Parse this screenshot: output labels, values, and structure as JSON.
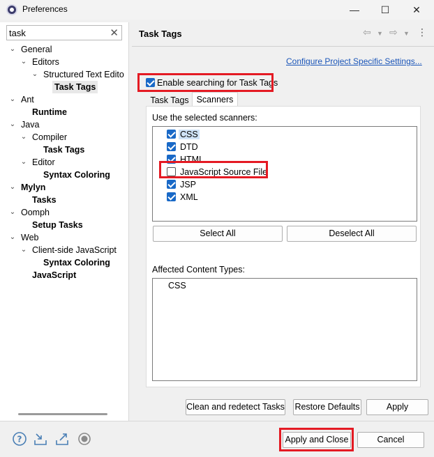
{
  "window": {
    "title": "Preferences",
    "minimize": "—",
    "maximize": "☐",
    "close": "✕"
  },
  "filter": {
    "value": "task",
    "clear_glyph": "✕"
  },
  "tree": {
    "general": "General",
    "editors": "Editors",
    "structured": "Structured Text Edito",
    "task_tags": "Task Tags",
    "ant": "Ant",
    "runtime": "Runtime",
    "java": "Java",
    "compiler": "Compiler",
    "java_task_tags": "Task Tags",
    "java_editor": "Editor",
    "java_syntax": "Syntax Coloring",
    "mylyn": "Mylyn",
    "mylyn_tasks": "Tasks",
    "oomph": "Oomph",
    "setup_tasks": "Setup Tasks",
    "web": "Web",
    "client_js": "Client-side JavaScript",
    "web_syntax": "Syntax Coloring",
    "javascript": "JavaScript"
  },
  "page": {
    "title": "Task Tags",
    "configure_link": "Configure Project Specific Settings...",
    "enable_label": "Enable searching for Task Tags",
    "enable_checked": true,
    "tabs": [
      "Task Tags",
      "Scanners"
    ],
    "active_tab": "Scanners",
    "scanners_label": "Use the selected scanners:",
    "scanners": [
      {
        "label": "CSS",
        "checked": true
      },
      {
        "label": "DTD",
        "checked": true
      },
      {
        "label": "HTML",
        "checked": true
      },
      {
        "label": "JavaScript Source File",
        "checked": false
      },
      {
        "label": "JSP",
        "checked": true
      },
      {
        "label": "XML",
        "checked": true
      }
    ],
    "select_all": "Select All",
    "deselect_all": "Deselect All",
    "content_types_label": "Affected Content Types:",
    "content_types": [
      "CSS"
    ],
    "clean_redetect": "Clean and redetect Tasks",
    "restore_defaults": "Restore Defaults",
    "apply": "Apply"
  },
  "footer": {
    "apply_close": "Apply and Close",
    "cancel": "Cancel",
    "icons": [
      "help-icon",
      "import-icon",
      "export-icon",
      "record-icon"
    ]
  },
  "colors": {
    "accent": "#1969c7",
    "highlight_box": "#e41a23",
    "link": "#1a55b8"
  }
}
